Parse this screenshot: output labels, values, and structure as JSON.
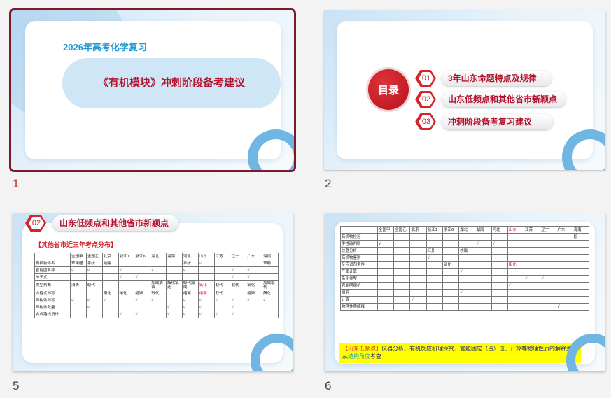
{
  "slides": [
    {
      "number": "1",
      "selected": true,
      "subtitle": "2026年高考化学复习",
      "title": "《有机模块》冲刺阶段备考建议"
    },
    {
      "number": "2",
      "selected": false,
      "toc_label": "目录",
      "items": [
        {
          "num": "01",
          "text": "3年山东命题特点及规律"
        },
        {
          "num": "02",
          "text": "山东低频点和其他省市新颖点"
        },
        {
          "num": "03",
          "text": "冲刺阶段备考复习建议"
        }
      ]
    },
    {
      "number": "5",
      "selected": false,
      "section_num": "02",
      "section_title": "山东低频点和其他省市新颖点",
      "label": "【其他省市近三年考点分布】",
      "columns": [
        "",
        "全国甲",
        "全国乙",
        "北京",
        "浙江1",
        "浙江6",
        "湖北",
        "湖南",
        "河北",
        "山东",
        "江苏",
        "辽宁",
        "广东",
        "海南"
      ],
      "rows": [
        [
          "有机物命名",
          "苯甲醛",
          "系统",
          "羧酸",
          "",
          "",
          "",
          "",
          "系统",
          "√",
          "",
          "",
          "",
          "苯酚"
        ],
        [
          "官能团名称",
          "√",
          "√",
          "",
          "√",
          "",
          "√",
          "",
          "√",
          "",
          "",
          "√",
          "√",
          ""
        ],
        [
          "分子式",
          "",
          "",
          "",
          "√",
          "√",
          "",
          "",
          "",
          "",
          "",
          "√",
          "√",
          ""
        ],
        [
          "类型判断",
          "消去",
          "取代",
          "",
          "",
          "",
          "加成消去",
          "酯化氧还",
          "取代加成",
          "氧化",
          "取代",
          "取代",
          "氧化",
          "加成取代"
        ],
        [
          "方程式书写",
          "",
          "",
          "酯化",
          "硝化",
          "缩聚",
          "取代",
          "",
          "缩聚",
          "缩聚",
          "取代",
          "",
          "缩聚",
          "酯化"
        ],
        [
          "异构体书写",
          "√",
          "√",
          "√",
          "",
          "√",
          "√",
          "",
          "√",
          "√",
          "√",
          "√",
          "√",
          "√"
        ],
        [
          "异构体数量",
          "",
          "√",
          "",
          "",
          "",
          "",
          "√",
          "√",
          "√",
          "",
          "√",
          "",
          ""
        ],
        [
          "合成路线设计",
          "",
          "",
          "",
          "√",
          "√",
          "",
          "√",
          "√",
          "√",
          "√",
          "√",
          "",
          ""
        ]
      ]
    },
    {
      "number": "6",
      "selected": false,
      "columns": [
        "",
        "全国甲",
        "全国乙",
        "北京",
        "浙江1",
        "浙江6",
        "湖北",
        "湖南",
        "河北",
        "山东",
        "江苏",
        "辽宁",
        "广东",
        "海南"
      ],
      "rows": [
        [
          "有机物检验",
          "",
          "",
          "",
          "",
          "",
          "",
          "",
          "",
          "",
          "",
          "",
          "",
          "酚"
        ],
        [
          "手性碳判断",
          "√",
          "",
          "",
          "",
          "",
          "",
          "√",
          "√",
          "",
          "",
          "",
          "",
          ""
        ],
        [
          "仪器分析",
          "",
          "",
          "",
          "红外",
          "",
          "核磁",
          "",
          "",
          "",
          "",
          "",
          "",
          ""
        ],
        [
          "有机物鉴别",
          "",
          "",
          "",
          "√",
          "",
          "",
          "",
          "",
          "",
          "",
          "",
          "",
          ""
        ],
        [
          "反应试剂条件",
          "",
          "",
          "",
          "",
          "硝化",
          "",
          "",
          "",
          "酯化",
          "",
          "",
          "",
          ""
        ],
        [
          "产率计算",
          "",
          "",
          "",
          "",
          "",
          "√",
          "",
          "",
          "",
          "",
          "",
          "",
          ""
        ],
        [
          "杂化类型",
          "",
          "",
          "",
          "",
          "",
          "",
          "",
          "",
          "",
          "√",
          "√",
          "",
          ""
        ],
        [
          "官能团保护",
          "",
          "",
          "",
          "",
          "",
          "",
          "",
          "",
          "√",
          "",
          "",
          "",
          ""
        ],
        [
          "探究",
          "",
          "",
          "",
          "",
          "",
          "√",
          "",
          "",
          "",
          "",
          "",
          "",
          ""
        ],
        [
          "计算",
          "",
          "",
          "√",
          "",
          "",
          "",
          "",
          "",
          "",
          "",
          "",
          "",
          ""
        ],
        [
          "物理性质解释",
          "",
          "",
          "",
          "",
          "",
          "",
          "",
          "",
          "",
          "",
          "",
          "√",
          ""
        ]
      ],
      "note_tag": "【山东低频点】",
      "note_body": "仪器分析、有机反应机理探究、官能团定（占）位、计算等物理性质的解释主要从",
      "note_blue": "结构角度",
      "note_end": "考查"
    }
  ],
  "colors": {
    "accent_red": "#b3152e",
    "accent_blue": "#1f9ad6",
    "selection": "#7a1b2c"
  }
}
